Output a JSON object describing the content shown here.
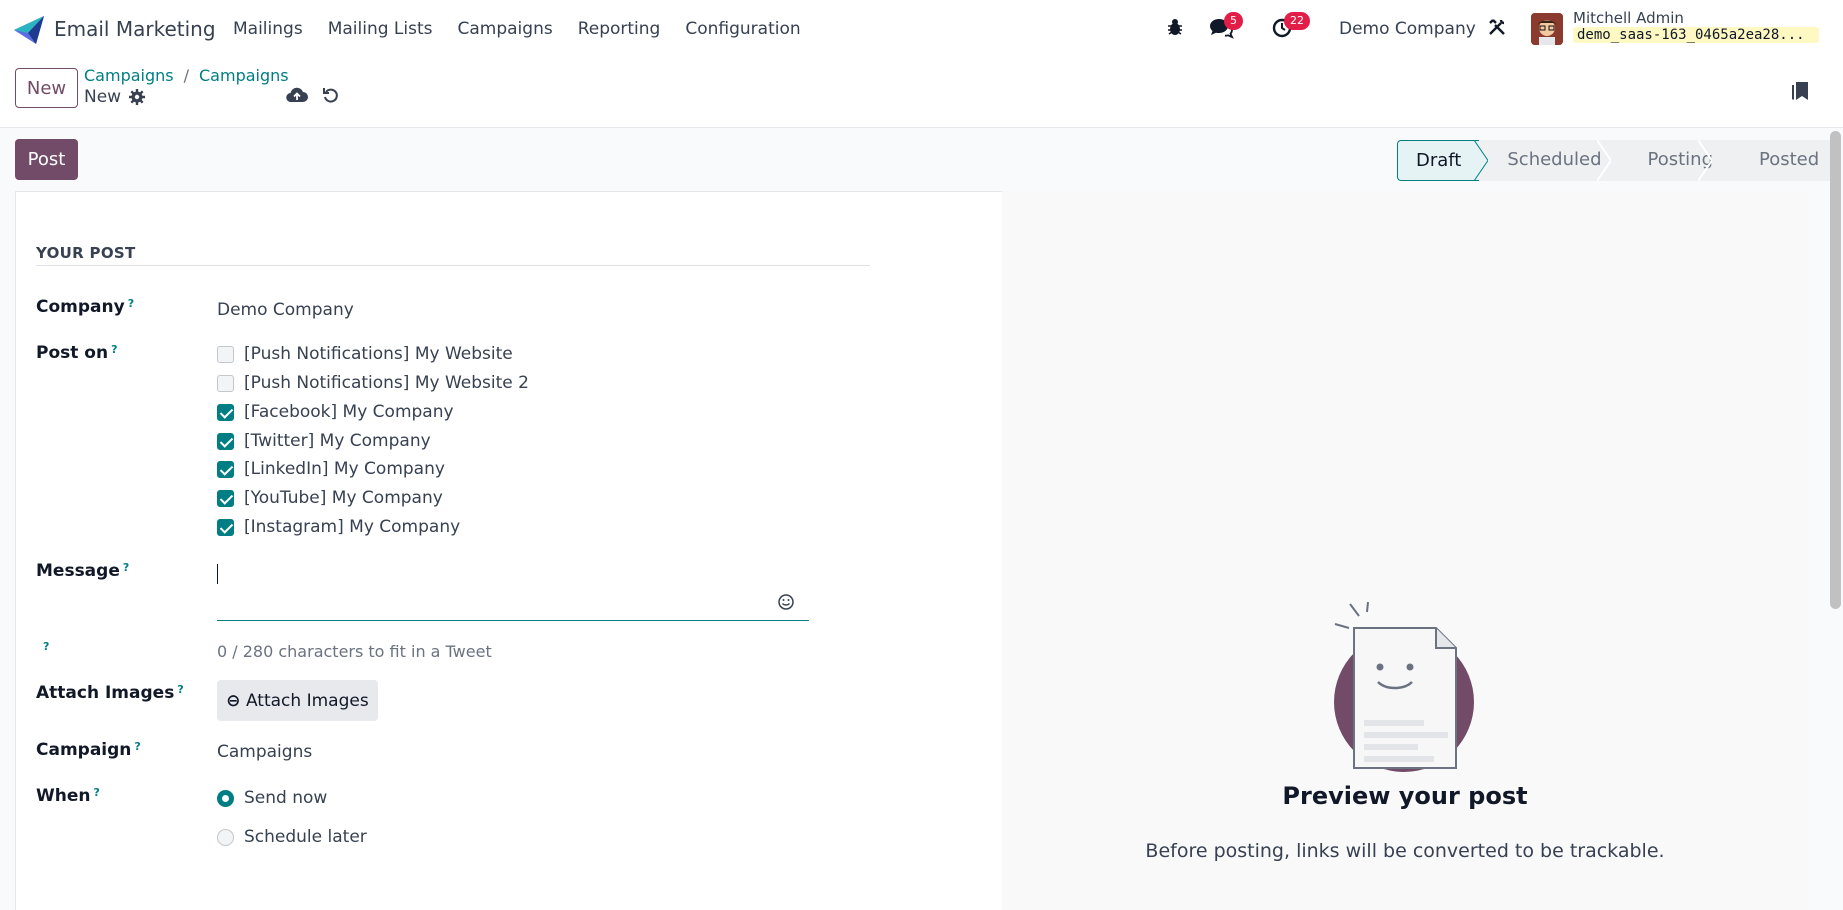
{
  "app": {
    "name": "Email Marketing"
  },
  "menu": [
    "Mailings",
    "Mailing Lists",
    "Campaigns",
    "Reporting",
    "Configuration"
  ],
  "systray": {
    "messages_count": "5",
    "activities_count": "22",
    "company": "Demo Company",
    "user_name": "Mitchell Admin",
    "database": "demo_saas-163_0465a2ea28..."
  },
  "control": {
    "new_label": "New",
    "breadcrumb": [
      "Campaigns",
      "Campaigns"
    ],
    "record_name": "New"
  },
  "status": {
    "post_label": "Post",
    "stages": [
      "Draft",
      "Scheduled",
      "Posting",
      "Posted"
    ],
    "current": "Draft"
  },
  "form": {
    "section_title": "YOUR POST",
    "company_label": "Company",
    "company_value": "Demo Company",
    "post_on_label": "Post on",
    "accounts": [
      {
        "label": "[Push Notifications] My Website",
        "checked": false
      },
      {
        "label": "[Push Notifications] My Website 2",
        "checked": false
      },
      {
        "label": "[Facebook] My Company",
        "checked": true
      },
      {
        "label": "[Twitter] My Company",
        "checked": true
      },
      {
        "label": "[LinkedIn] My Company",
        "checked": true
      },
      {
        "label": "[YouTube] My Company",
        "checked": true
      },
      {
        "label": "[Instagram] My Company",
        "checked": true
      }
    ],
    "message_label": "Message",
    "message_value": "",
    "char_count": "0 / 280 characters to fit in a Tweet",
    "attach_label": "Attach Images",
    "attach_button": "Attach Images",
    "campaign_label": "Campaign",
    "campaign_value": "Campaigns",
    "when_label": "When",
    "when_options": [
      {
        "label": "Send now",
        "selected": true
      },
      {
        "label": "Schedule later",
        "selected": false
      }
    ]
  },
  "preview": {
    "title": "Preview your post",
    "subtitle": "Before posting, links will be converted to be trackable."
  },
  "colors": {
    "primary": "#714b67",
    "accent": "#017e84",
    "badge": "#e11d48"
  }
}
